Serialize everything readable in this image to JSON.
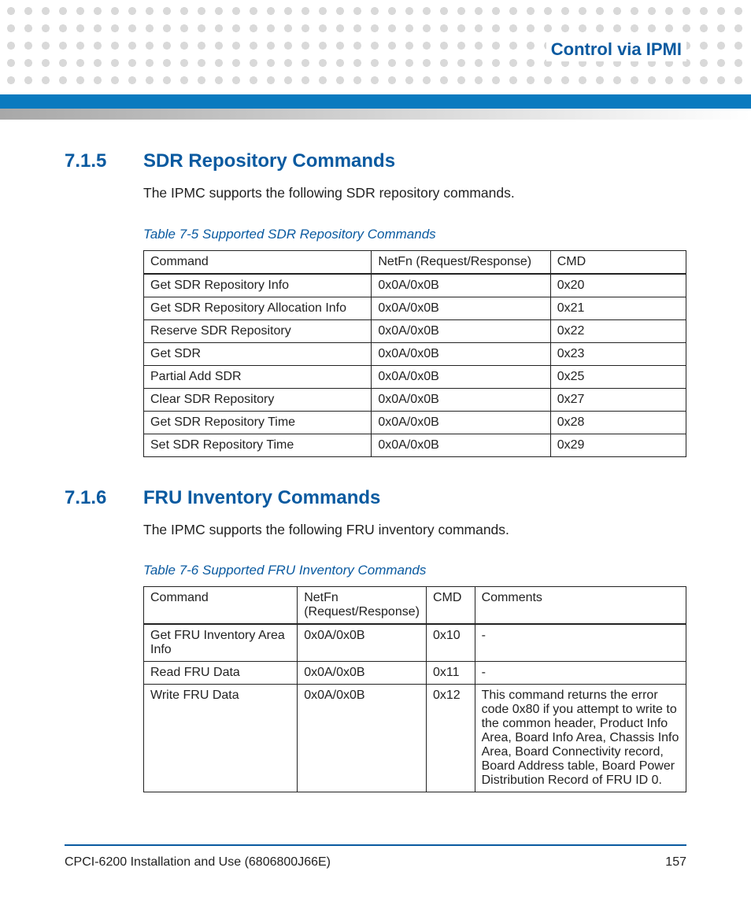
{
  "header": {
    "title": "Control via IPMI"
  },
  "section1": {
    "number": "7.1.5",
    "title": "SDR Repository Commands",
    "body": "The IPMC supports the following SDR repository commands.",
    "table_caption": "Table 7-5 Supported SDR Repository Commands",
    "headers": {
      "c1": "Command",
      "c2": "NetFn (Request/Response)",
      "c3": "CMD"
    },
    "rows": [
      {
        "c1": "Get SDR Repository Info",
        "c2": "0x0A/0x0B",
        "c3": "0x20"
      },
      {
        "c1": "Get SDR Repository Allocation Info",
        "c2": "0x0A/0x0B",
        "c3": "0x21"
      },
      {
        "c1": "Reserve SDR Repository",
        "c2": "0x0A/0x0B",
        "c3": "0x22"
      },
      {
        "c1": "Get SDR",
        "c2": "0x0A/0x0B",
        "c3": "0x23"
      },
      {
        "c1": "Partial Add SDR",
        "c2": "0x0A/0x0B",
        "c3": "0x25"
      },
      {
        "c1": "Clear SDR Repository",
        "c2": "0x0A/0x0B",
        "c3": "0x27"
      },
      {
        "c1": "Get SDR Repository Time",
        "c2": "0x0A/0x0B",
        "c3": "0x28"
      },
      {
        "c1": "Set SDR Repository Time",
        "c2": "0x0A/0x0B",
        "c3": "0x29"
      }
    ]
  },
  "section2": {
    "number": "7.1.6",
    "title": "FRU Inventory Commands",
    "body": "The IPMC supports the following FRU inventory commands.",
    "table_caption": "Table 7-6 Supported FRU Inventory Commands",
    "headers": {
      "c1": "Command",
      "c2": "NetFn (Request/Response)",
      "c3": "CMD",
      "c4": "Comments"
    },
    "rows": [
      {
        "c1": "Get FRU Inventory Area Info",
        "c2": "0x0A/0x0B",
        "c3": "0x10",
        "c4": "-"
      },
      {
        "c1": "Read FRU Data",
        "c2": "0x0A/0x0B",
        "c3": "0x11",
        "c4": "-"
      },
      {
        "c1": "Write FRU Data",
        "c2": "0x0A/0x0B",
        "c3": "0x12",
        "c4": "This command returns the error code 0x80 if you attempt to write to the common header, Product Info Area, Board Info Area, Chassis Info Area, Board Connectivity record, Board Address table, Board Power Distribution Record of FRU ID 0."
      }
    ]
  },
  "footer": {
    "doc": "CPCI-6200 Installation and Use (6806800J66E)",
    "page": "157"
  }
}
